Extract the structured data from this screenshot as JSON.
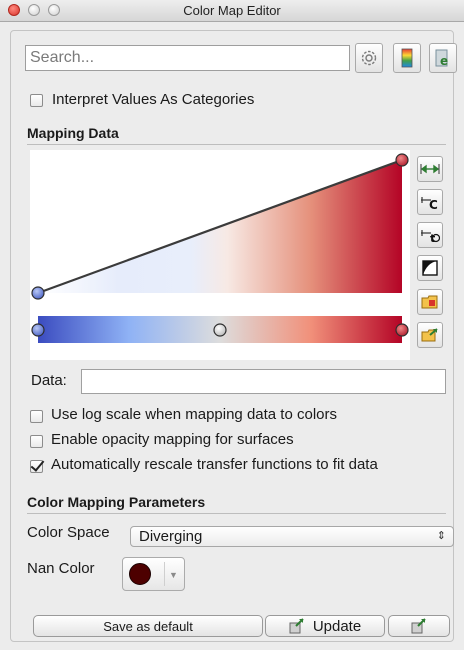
{
  "window": {
    "title": "Color Map Editor"
  },
  "search": {
    "placeholder": "Search..."
  },
  "toolbar": {
    "icons": [
      "gear-icon",
      "color-bar-icon",
      "paraview-icon"
    ]
  },
  "interpret_categories": {
    "label": "Interpret Values As Categories",
    "checked": false
  },
  "mapping_data": {
    "title": "Mapping Data",
    "side_icons": [
      "rescale-range-icon",
      "rescale-custom-icon",
      "rescale-temporal-icon",
      "invert-icon",
      "choose-preset-icon",
      "save-preset-icon"
    ],
    "colors": {
      "low": "#3b4cc0",
      "mid": "#dddddd",
      "high": "#b40426"
    },
    "opacity_points": [
      {
        "x": 0,
        "opacity": 0
      },
      {
        "x": 1,
        "opacity": 1
      }
    ],
    "color_points": [
      0,
      0.5,
      1
    ]
  },
  "data_field": {
    "label": "Data:",
    "value": ""
  },
  "options": [
    {
      "label": "Use log scale when mapping data to colors",
      "checked": false
    },
    {
      "label": "Enable opacity mapping for surfaces",
      "checked": false
    },
    {
      "label": "Automatically rescale transfer functions to fit data",
      "checked": true
    }
  ],
  "params": {
    "title": "Color Mapping Parameters",
    "color_space_label": "Color Space",
    "color_space_value": "Diverging",
    "nan_label": "Nan Color",
    "nan_color": "#4d0000"
  },
  "buttons": {
    "save_default": "Save as default",
    "update": "Update"
  }
}
